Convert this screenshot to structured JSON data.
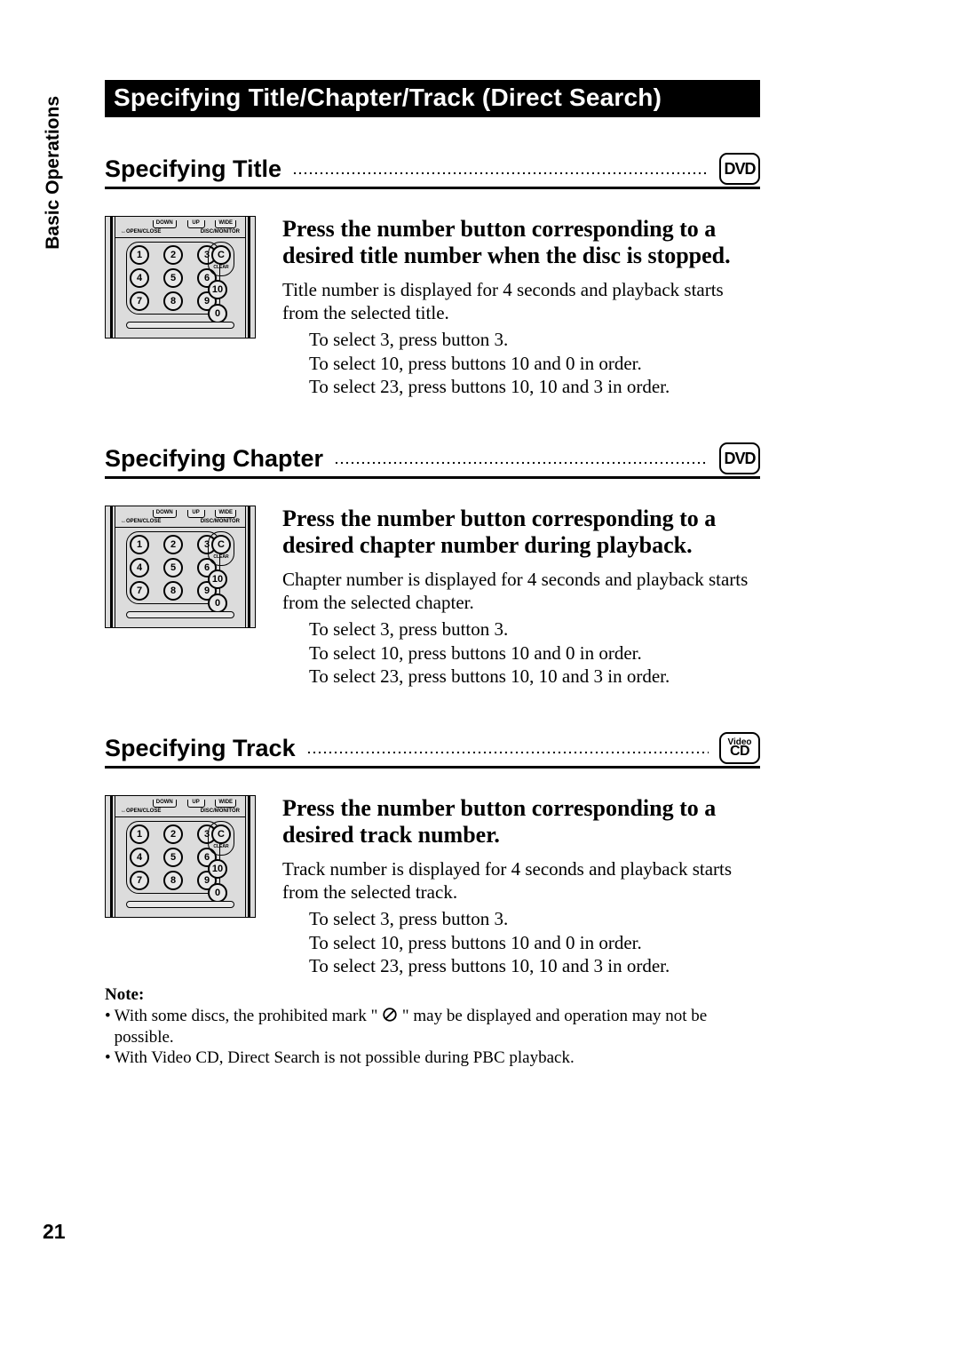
{
  "sidebar": {
    "label": "Basic Operations"
  },
  "pageNumber": "21",
  "main_heading": "Specifying Title/Chapter/Track (Direct Search)",
  "badges": {
    "dvd": "DVD",
    "video": "Video",
    "cd": "CD"
  },
  "remote": {
    "top_buttons": [
      "DOWN",
      "UP",
      "WIDE"
    ],
    "label_left": "↔OPEN/CLOSE",
    "label_right": "DISC/MONITOR",
    "keys_grid": [
      [
        "1",
        "2",
        "3"
      ],
      [
        "4",
        "5",
        "6"
      ],
      [
        "7",
        "8",
        "9"
      ]
    ],
    "keys_right": {
      "c": "C",
      "c_label": "CLEAR",
      "ten": "10",
      "zero": "0"
    }
  },
  "sections": {
    "title": {
      "heading": "Specifying Title",
      "lead": "Press the number button corresponding to a desired title number when the disc is stopped.",
      "desc": "Title number is displayed for 4 seconds and playback starts from the selected title.",
      "examples": [
        "To select 3, press button 3.",
        "To select 10, press buttons 10 and 0 in order.",
        "To select 23, press buttons 10, 10 and 3 in order."
      ]
    },
    "chapter": {
      "heading": "Specifying Chapter",
      "lead": "Press the number button corresponding to a desired chapter number during playback.",
      "desc": "Chapter number is displayed for 4 seconds and playback starts from the selected chapter.",
      "examples": [
        "To select 3, press button 3.",
        "To select 10, press buttons 10 and 0 in order.",
        "To select 23, press buttons 10, 10 and 3 in order."
      ]
    },
    "track": {
      "heading": "Specifying Track",
      "lead": "Press the number button corresponding to a desired track number.",
      "desc": "Track number is displayed for 4 seconds and playback starts from the selected track.",
      "examples": [
        "To select 3, press button 3.",
        "To select 10, press buttons 10 and 0 in order.",
        "To select 23, press buttons 10, 10 and 3 in order."
      ]
    }
  },
  "note": {
    "title": "Note:",
    "items_pre": "With some discs, the prohibited mark \"",
    "items_post": "\" may be displayed and operation may not be possible.",
    "item2": "With Video CD, Direct Search is not possible during PBC playback."
  }
}
